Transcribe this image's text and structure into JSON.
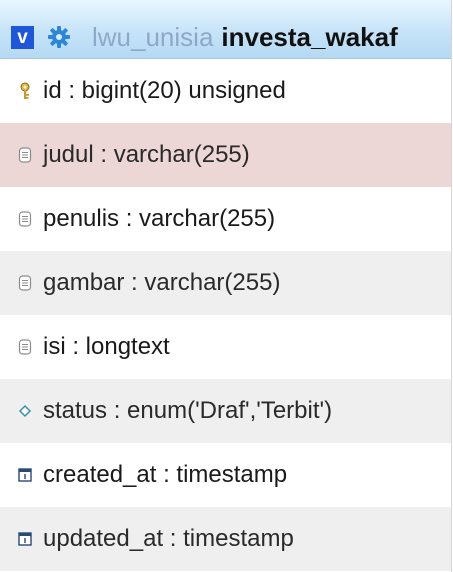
{
  "header": {
    "toggle_label": "v",
    "database": "lwu_unisia",
    "table": "investa_wakaf"
  },
  "columns": [
    {
      "text": "id : bigint(20) unsigned",
      "icon": "primary-key-icon"
    },
    {
      "text": "judul : varchar(255)",
      "icon": "text-column-icon"
    },
    {
      "text": "penulis : varchar(255)",
      "icon": "text-column-icon"
    },
    {
      "text": "gambar : varchar(255)",
      "icon": "text-column-icon"
    },
    {
      "text": "isi : longtext",
      "icon": "text-column-icon"
    },
    {
      "text": "status : enum('Draf','Terbit')",
      "icon": "enum-column-icon"
    },
    {
      "text": "created_at : timestamp",
      "icon": "timestamp-column-icon"
    },
    {
      "text": "updated_at : timestamp",
      "icon": "timestamp-column-icon"
    }
  ],
  "colors": {
    "header_bg": "#c6e3f8",
    "toggle_bg": "#1f57d6",
    "highlight_row": "#ecd6d6",
    "alt_row": "#efefef"
  }
}
